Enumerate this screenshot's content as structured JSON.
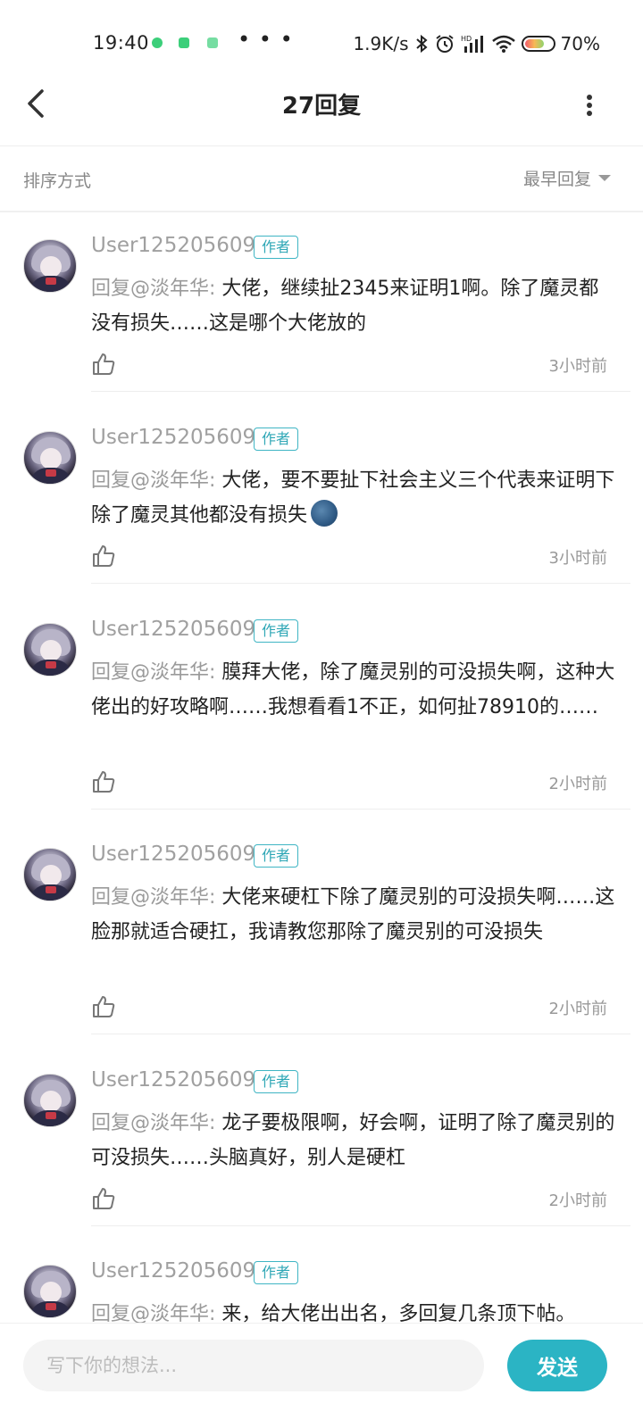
{
  "status_bar": {
    "time": "19:40",
    "more": "• • •",
    "net_speed": "1.9K/s",
    "battery": "70%",
    "battery_level": 0.7
  },
  "header": {
    "title": "27回复"
  },
  "sort": {
    "label": "排序方式",
    "selected": "最早回复"
  },
  "replies": [
    {
      "username": "User125205609",
      "badge": "作者",
      "mention": "回复@淡年华: ",
      "text": "大佬，继续扯2345来证明1啊。除了魔灵都没有损失……这是哪个大佬放的",
      "time": "3小时前"
    },
    {
      "username": "User125205609",
      "badge": "作者",
      "mention": "回复@淡年华: ",
      "text": "大佬，要不要扯下社会主义三个代表来证明下除了魔灵其他都没有损失",
      "time": "3小时前",
      "emoji": "moon-face"
    },
    {
      "username": "User125205609",
      "badge": "作者",
      "mention": "回复@淡年华: ",
      "text": "膜拜大佬，除了魔灵别的可没损失啊，这种大佬出的好攻略啊……我想看看1不正，如何扯78910的……",
      "time": "2小时前"
    },
    {
      "username": "User125205609",
      "badge": "作者",
      "mention": "回复@淡年华: ",
      "text": "大佬来硬杠下除了魔灵别的可没损失啊……这脸那就适合硬扛，我请教您那除了魔灵别的可没损失",
      "time": "2小时前"
    },
    {
      "username": "User125205609",
      "badge": "作者",
      "mention": "回复@淡年华: ",
      "text": "龙子要极限啊，好会啊，证明了除了魔灵别的可没损失……头脑真好，别人是硬杠",
      "time": "2小时前"
    },
    {
      "username": "User125205609",
      "badge": "作者",
      "mention": "回复@淡年华: ",
      "text": "来，给大佬出出名，多回复几条顶下帖。",
      "time": ""
    }
  ],
  "compose": {
    "placeholder": "写下你的想法...",
    "send_label": "发送"
  },
  "colors": {
    "accent": "#2bb4c4"
  }
}
